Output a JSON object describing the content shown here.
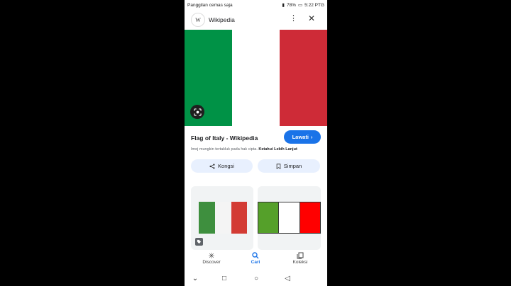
{
  "status": {
    "left_text": "Panggilan cemas saja",
    "battery": "78%",
    "time": "5:22 PTG"
  },
  "header": {
    "logo_letter": "W",
    "site": "Wikipedia",
    "more_icon": "more-vert-icon",
    "close_icon": "close-icon"
  },
  "result": {
    "title": "Flag of Italy - Wikipedia",
    "visit_label": "Lawati",
    "copyright_text": "Imej mungkin tertakluk pada hak cipta.",
    "learn_more": "Ketahui Lebih Lanjut",
    "share_label": "Kongsi",
    "save_label": "Simpan"
  },
  "colors": {
    "flag_green": "#009246",
    "flag_white": "#ffffff",
    "flag_red": "#ce2b37",
    "accent": "#1a73e8"
  },
  "nav": {
    "items": [
      {
        "label": "Discover",
        "icon": "asterisk-icon"
      },
      {
        "label": "Cari",
        "icon": "search-icon"
      },
      {
        "label": "Koleksi",
        "icon": "collections-icon"
      }
    ]
  }
}
